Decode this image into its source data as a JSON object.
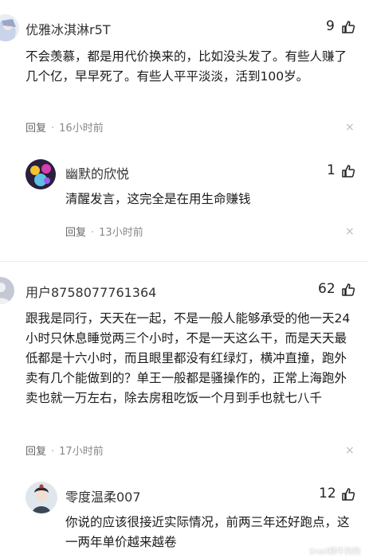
{
  "comments": [
    {
      "user": "优雅冰淇淋r5T",
      "likes": "9",
      "text": "不会羡慕，都是用代价换来的，比如没头发了。有些人赚了几个亿，早早死了。有些人平平淡淡，活到100岁。",
      "reply_label": "回复",
      "time": "16小时前",
      "avatar_icon": "anime-avatar-icon"
    },
    {
      "user": "幽默的欣悦",
      "likes": "1",
      "text": "清醒发言，这完全是在用生命赚钱",
      "reply_label": "回复",
      "time": "13小时前",
      "avatar_icon": "colorful-avatar-icon"
    },
    {
      "user": "用户8758077761364",
      "likes": "62",
      "text": "跟我是同行，天天在一起，不是一般人能够承受的他一天24小时只休息睡觉两三个小时，不是一天这么干，而是天天最低都是十六小时，而且眼里都没有红绿灯，横冲直撞，跑外卖有几个能做到的？单王一般都是骚操作的，正常上海跑外卖也就一万左右，除去房租吃饭一个月到手也就七八千",
      "reply_label": "回复",
      "time": "17小时前",
      "avatar_icon": "default-avatar-icon"
    },
    {
      "user": "零度温柔007",
      "likes": "12",
      "text": "你说的应该很接近实际情况，前两三年还好跑点，这一两年单价越来越卷",
      "avatar_icon": "costume-avatar-icon"
    }
  ],
  "icons": {
    "like": "thumbs-up-icon",
    "close": "close-icon"
  },
  "close_glyph": "×",
  "dot": "·",
  "watermark": "Snail蜗牛狗狗"
}
